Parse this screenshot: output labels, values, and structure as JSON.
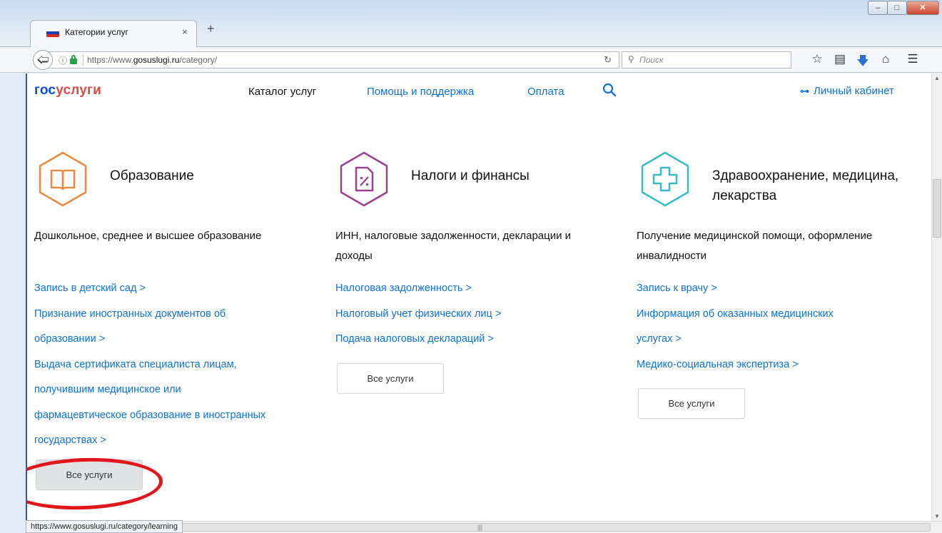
{
  "browser": {
    "tab_title": "Категории услуг",
    "tab_close": "×",
    "new_tab": "+",
    "url_host": "https://www.",
    "url_domain": "gosuslugi.ru",
    "url_path": "/category/",
    "search_placeholder": "Поиск",
    "status_url": "https://www.gosuslugi.ru/category/learning"
  },
  "site": {
    "logo_part1": "гос",
    "logo_part2": "услуги",
    "nav": {
      "catalog": "Каталог услуг",
      "help": "Помощь и поддержка",
      "payment": "Оплата"
    },
    "cabinet": "Личный кабинет"
  },
  "categories": [
    {
      "title": "Образование",
      "description": "Дошкольное, среднее и высшее образование",
      "links": [
        "Запись в детский сад >",
        "Признание иностранных документов об образовании >",
        "Выдача сертификата специалиста лицам, получившим медицинское или фармацевтическое образование в иностранных государствах >"
      ],
      "button": "Все услуги",
      "color": "#e98a3c"
    },
    {
      "title": "Налоги и финансы",
      "description": "ИНН, налоговые задолженности, декларации и доходы",
      "links": [
        "Налоговая задолженность >",
        "Налоговый учет физических лиц >",
        "Подача налоговых деклараций >"
      ],
      "button": "Все услуги",
      "color": "#9b3f8f"
    },
    {
      "title": "Здравоохранение, медицина, лекарства",
      "description": "Получение медицинской помощи, оформление инвалидности",
      "links": [
        "Запись к врачу >",
        "Информация об оказанных медицинских услугах >",
        "Медико-социальная экспертиза >"
      ],
      "button": "Все услуги",
      "color": "#39bcc4"
    }
  ]
}
